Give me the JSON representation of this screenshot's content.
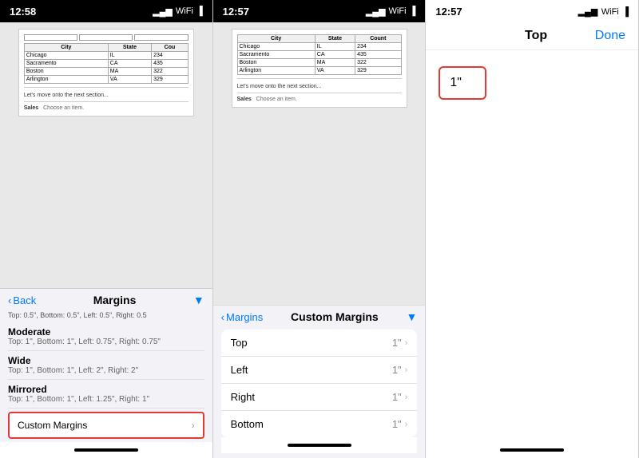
{
  "panel1": {
    "statusBar": {
      "time": "12:58",
      "icons": [
        "▂▄▆",
        "WiFi",
        "🔋"
      ]
    },
    "table": {
      "headers": [
        "City",
        "State",
        "Cou"
      ],
      "rows": [
        [
          "Chicago",
          "IL",
          "234"
        ],
        [
          "Sacramento",
          "CA",
          "435"
        ],
        [
          "Boston",
          "MA",
          "322"
        ],
        [
          "Arlington",
          "VA",
          "329"
        ]
      ]
    },
    "docText": "Let's move onto the next section...",
    "salesLabel": "Sales",
    "salesPlaceholder": "Choose an item.",
    "nav": {
      "backLabel": "Back",
      "title": "Margins"
    },
    "marginItems": [
      {
        "title": "Moderate",
        "subtitle": "Top: 1\", Bottom: 1\", Left: 0.75\", Right: 0.75\""
      },
      {
        "title": "Wide",
        "subtitle": "Top: 1\", Bottom: 1\", Left: 2\", Right: 2\""
      },
      {
        "title": "Mirrored",
        "subtitle": "Top: 1\", Bottom: 1\", Left: 1.25\", Right: 1\""
      }
    ],
    "customMarginsLabel": "Custom Margins",
    "customMarginsArrow": "›",
    "scrollIndicator": "Top: 0.5\", Bottom: 0.5\", Left: 0.5\", Right: 0.5"
  },
  "panel2": {
    "statusBar": {
      "time": "12:57",
      "icons": [
        "▂▄▆",
        "WiFi",
        "🔋"
      ]
    },
    "table": {
      "headers": [
        "City",
        "State",
        "Count"
      ],
      "rows": [
        [
          "Chicago",
          "IL",
          "234"
        ],
        [
          "Sacramento",
          "CA",
          "435"
        ],
        [
          "Boston",
          "MA",
          "322"
        ],
        [
          "Arlington",
          "VA",
          "329"
        ]
      ]
    },
    "docText": "Let's move onto the next section...",
    "salesLabel": "Sales",
    "salesPlaceholder": "Choose an item.",
    "nav": {
      "backLabel": "Margins",
      "title": "Custom Margins"
    },
    "rows": [
      {
        "label": "Top",
        "value": "1\"",
        "arrow": "›"
      },
      {
        "label": "Left",
        "value": "1\"",
        "arrow": "›"
      },
      {
        "label": "Right",
        "value": "1\"",
        "arrow": "›"
      },
      {
        "label": "Bottom",
        "value": "1\"",
        "arrow": "›"
      }
    ]
  },
  "panel3": {
    "statusBar": {
      "time": "12:57",
      "icons": [
        "▂▄▆",
        "WiFi",
        "🔋"
      ]
    },
    "header": {
      "title": "Top",
      "doneLabel": "Done"
    },
    "inputValue": "1\""
  }
}
